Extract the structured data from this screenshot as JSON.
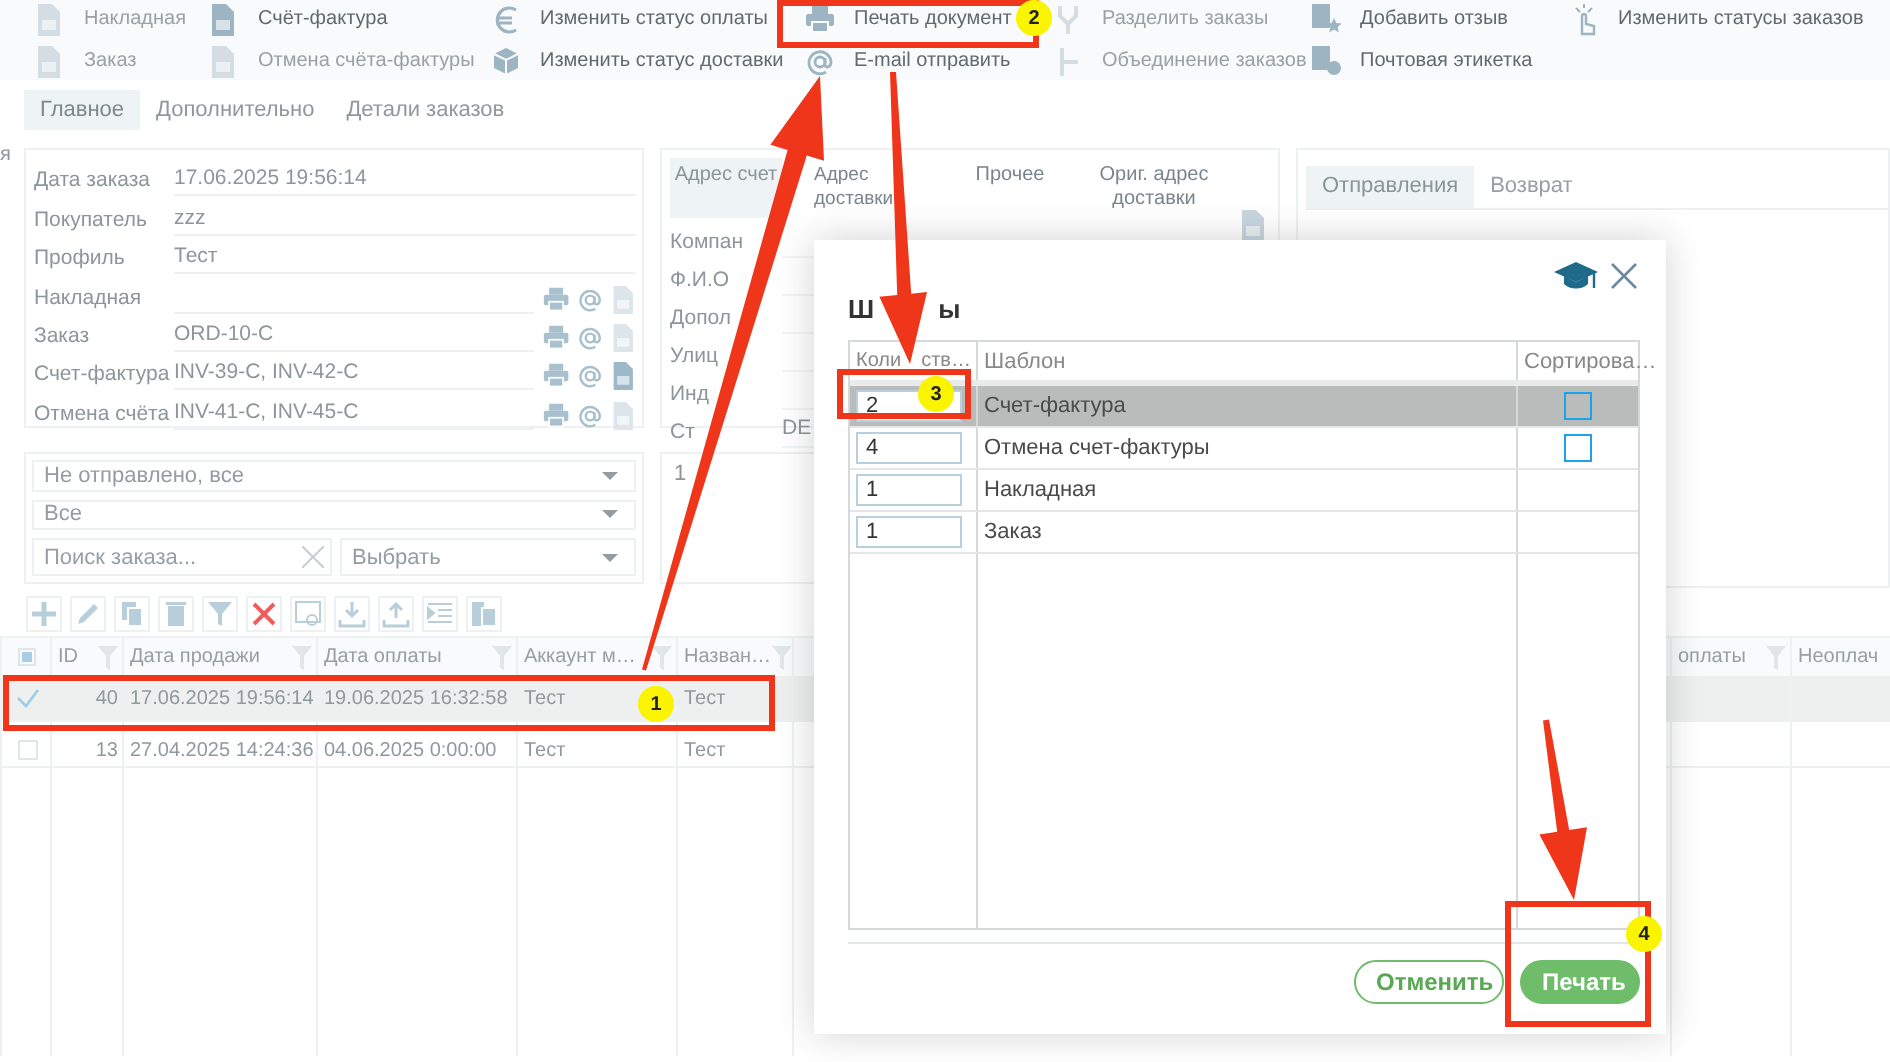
{
  "left_edge_text": "я",
  "toolbar": [
    {
      "items": [
        {
          "label": "Накладная",
          "kind": "doc",
          "disabled": true
        },
        {
          "label": "Заказ",
          "kind": "doc",
          "disabled": true
        }
      ]
    },
    {
      "items": [
        {
          "label": "Счёт-фактура",
          "kind": "doc",
          "disabled": false
        },
        {
          "label": "Отмена счёта-фактуры",
          "kind": "doc",
          "disabled": true
        }
      ]
    },
    {
      "items": [
        {
          "label": "Изменить статус оплаты",
          "kind": "euro",
          "disabled": false
        },
        {
          "label": "Изменить статус доставки",
          "kind": "box",
          "disabled": false
        }
      ]
    },
    {
      "items": [
        {
          "label": "Печать документ",
          "kind": "printer",
          "disabled": false
        },
        {
          "label": "E-mail отправить",
          "kind": "at",
          "disabled": false
        }
      ]
    },
    {
      "items": [
        {
          "label": "Разделить заказы",
          "kind": "split",
          "disabled": true
        },
        {
          "label": "Объединение заказов",
          "kind": "merge",
          "disabled": true
        }
      ]
    },
    {
      "items": [
        {
          "label": "Добавить отзыв",
          "kind": "star",
          "disabled": false
        },
        {
          "label": "Почтовая этикетка",
          "kind": "label",
          "disabled": false
        }
      ]
    },
    {
      "items": [
        {
          "label": "Изменить статусы заказов",
          "kind": "touch",
          "disabled": false
        }
      ]
    }
  ],
  "tabs": [
    {
      "label": "Главное",
      "selected": true
    },
    {
      "label": "Дополнительно",
      "selected": false
    },
    {
      "label": "Детали заказов",
      "selected": false
    }
  ],
  "order_form": {
    "fields": [
      {
        "label": "Дата заказа",
        "value": "17.06.2025 19:56:14"
      },
      {
        "label": "Покупатель",
        "value": "zzz"
      },
      {
        "label": "Профиль",
        "value": "Тест"
      },
      {
        "label": "Накладная",
        "doc_active": false
      },
      {
        "label": "Заказ",
        "value": "ORD-10-C",
        "doc_active": false
      },
      {
        "label": "Счет-фактура",
        "value": "INV-39-C, INV-42-C",
        "doc_active": true
      },
      {
        "label": "Отмена счёта",
        "value": "INV-41-C, INV-45-C",
        "doc_active": false
      }
    ]
  },
  "address_panel": {
    "tabs": [
      {
        "label": "Адрес счет",
        "selected": true
      },
      {
        "label": "Адрес доставки",
        "selected": false
      },
      {
        "label": "Прочее",
        "selected": false
      },
      {
        "label": "Ориг. адрес доставки",
        "selected": false
      }
    ],
    "fields": [
      {
        "label": "Компан"
      },
      {
        "label": "Ф.И.О"
      },
      {
        "label": "Допол"
      },
      {
        "label": "Улиц"
      },
      {
        "label": "Инд"
      },
      {
        "label": "Ст",
        "value": "DE"
      }
    ]
  },
  "shipments_panel": {
    "tabs": [
      {
        "label": "Отправления",
        "selected": true
      },
      {
        "label": "Возврат",
        "selected": false
      }
    ]
  },
  "filters": {
    "status": "Не отправлено, все",
    "scope": "Все",
    "search": {
      "placeholder": "Поиск заказа..."
    },
    "select": "Выбрать"
  },
  "lower_panel_text": "1",
  "grid": {
    "select_all_partial": true,
    "columns": [
      "ID",
      "Дата продажи",
      "Дата оплаты",
      "Аккаунт м…",
      "Назван…",
      "оплаты",
      "Неоплач"
    ],
    "rows": [
      {
        "selected": true,
        "checked": true,
        "cells": [
          "40",
          "17.06.2025 19:56:14",
          "19.06.2025 16:32:58",
          "Тест",
          "Тест"
        ]
      },
      {
        "selected": false,
        "checked": false,
        "cells": [
          "13",
          "27.04.2025 14:24:36",
          "04.06.2025 0:00:00",
          "Тест",
          "Тест"
        ]
      }
    ]
  },
  "dialog": {
    "title_parts": [
      "Ш",
      "ы"
    ],
    "columns": [
      [
        "Коли",
        "ств…"
      ],
      [
        "Шаблон"
      ],
      [
        "Сортирова…"
      ]
    ],
    "rows": [
      {
        "quantity": "2",
        "template": "Счет-фактура",
        "selected": true,
        "sort": {
          "checked": false
        }
      },
      {
        "quantity": "4",
        "template": "Отмена счет-фактуры",
        "selected": false,
        "sort": {
          "checked": false
        }
      },
      {
        "quantity": "1",
        "template": "Накладная",
        "selected": false
      },
      {
        "quantity": "1",
        "template": "Заказ",
        "selected": false
      }
    ],
    "buttons": [
      {
        "label": "Отменить",
        "kind": "secondary"
      },
      {
        "label": "Печать",
        "kind": "primary"
      }
    ]
  },
  "annotations": [
    {
      "badge": "1"
    },
    {
      "badge": "2"
    },
    {
      "badge": "3"
    },
    {
      "badge": "4"
    }
  ]
}
